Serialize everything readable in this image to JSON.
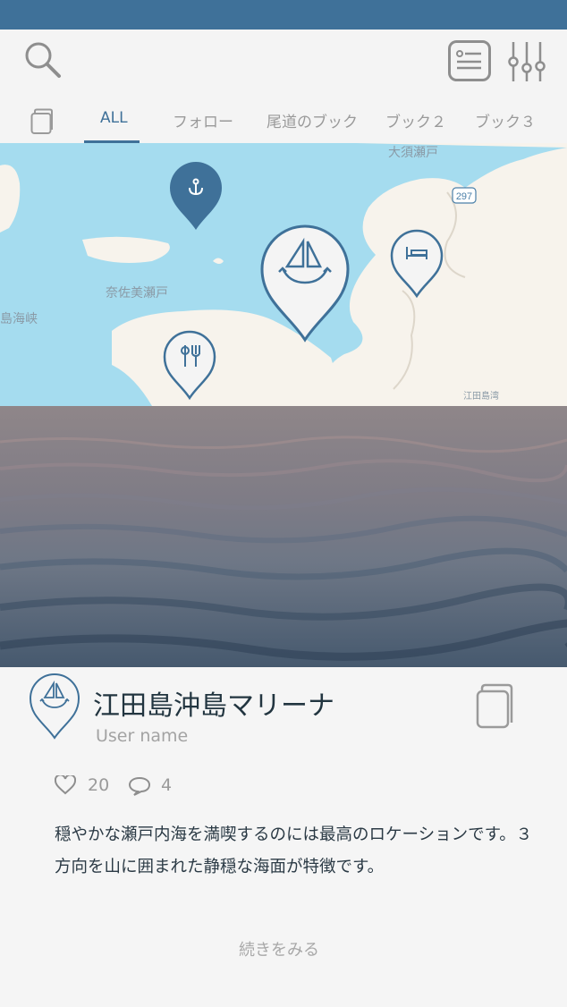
{
  "tabs": [
    {
      "label": "ALL",
      "active": true
    },
    {
      "label": "フォロー",
      "active": false
    },
    {
      "label": "尾道のブック",
      "active": false
    },
    {
      "label": "ブック２",
      "active": false
    },
    {
      "label": "ブック３",
      "active": false
    }
  ],
  "map": {
    "labels": [
      "大須瀬戸",
      "奈佐美瀬戸",
      "島海峡",
      "江田島湾"
    ],
    "route_badge": "297",
    "pins": [
      {
        "icon": "anchor-icon",
        "selected": false
      },
      {
        "icon": "sailboat-icon",
        "selected": true
      },
      {
        "icon": "bed-icon",
        "selected": false
      },
      {
        "icon": "fork-knife-icon",
        "selected": false
      }
    ]
  },
  "post": {
    "title": "江田島沖島マリーナ",
    "username": "User name",
    "likes": "20",
    "comments": "4",
    "description": "穏やかな瀬戸内海を満喫するのには最高のロケーションです。３方向を山に囲まれた静穏な海面が特徴です。",
    "more_label": "続きをみる"
  },
  "colors": {
    "accent": "#3f7199",
    "map_water": "#a5dcef",
    "map_land": "#f7f3ec"
  },
  "icons": [
    "search-icon",
    "list-view-icon",
    "filter-sliders-icon",
    "book-icon",
    "heart-icon",
    "comment-icon"
  ]
}
